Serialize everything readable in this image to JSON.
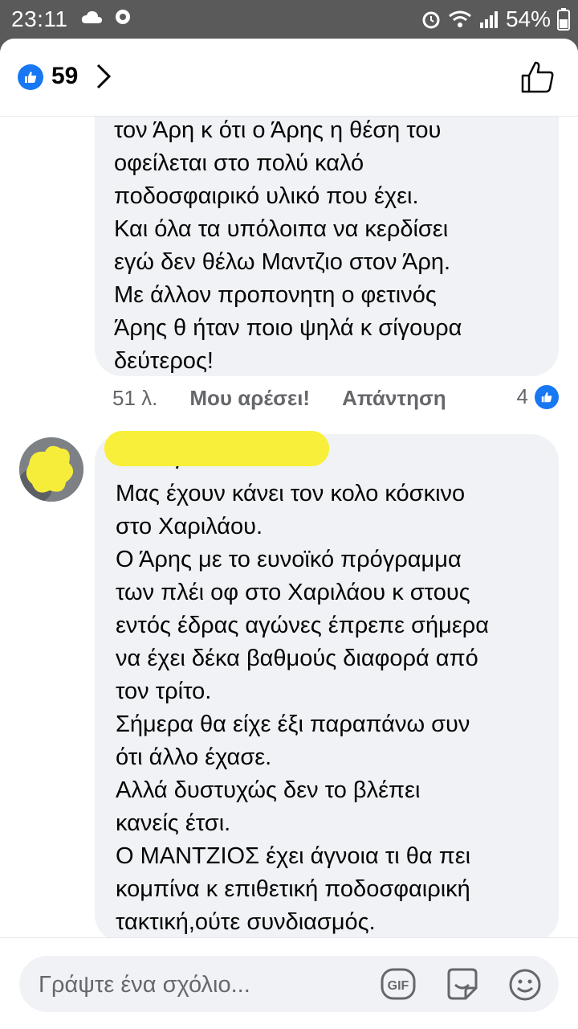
{
  "status": {
    "time": "23:11",
    "battery": "54%"
  },
  "header": {
    "like_count": "59"
  },
  "comment1": {
    "lines": [
      "τον Άρη κ ότι ο Άρης η θέση του",
      "οφείλεται στο πολύ καλό",
      "ποδοσφαιρικό υλικό που έχει.",
      "Και όλα τα υπόλοιπα να κερδίσει",
      "εγώ δεν θέλω Μαντζιο στον Άρη.",
      "Με άλλον προπονητη ο φετινός",
      "Άρης θ ήταν ποιο ψηλά κ σίγουρα",
      "δεύτερος!"
    ],
    "time_ago": "51 λ.",
    "like_label": "Μου αρέσει!",
    "reply_label": "Απάντηση",
    "reaction_count": "4"
  },
  "comment2": {
    "author": "Ντίνος",
    "lines": [
      "Μας έχουν κάνει τον κολο κόσκινο",
      "στο Χαριλάου.",
      "Ο Άρης με το ευνοϊκό πρόγραμμα",
      "των πλέι οφ στο Χαριλάου κ στους",
      "εντός έδρας αγώνες έπρεπε σήμερα",
      "να έχει δέκα βαθμούς διαφορά από",
      "τον τρίτο.",
      "Σήμερα θα είχε έξι παραπάνω συν",
      "ότι άλλο έχασε.",
      "Αλλά δυστυχώς δεν το βλέπει",
      "κανείς έτσι.",
      "Ο ΜΑΝΤΖΙΟΣ έχει άγνοια τι θα πει",
      "κομπίνα κ επιθετική ποδοσφαιρική",
      "τακτική,ούτε συνδιασμός."
    ]
  },
  "composer": {
    "placeholder": "Γράψτε ένα σχόλιο...",
    "gif_label": "GIF"
  },
  "icons": [
    "cloud-icon",
    "sync-icon",
    "alarm-icon",
    "wifi-icon",
    "signal-icon",
    "battery-icon",
    "like-reaction-icon",
    "chevron-right-icon",
    "thumbs-up-outline-icon",
    "gif-icon",
    "sticker-icon",
    "emoji-icon"
  ],
  "colors": {
    "accent": "#1877f2",
    "bubble": "#f0f2f5",
    "highlight": "#f8ef3a"
  }
}
